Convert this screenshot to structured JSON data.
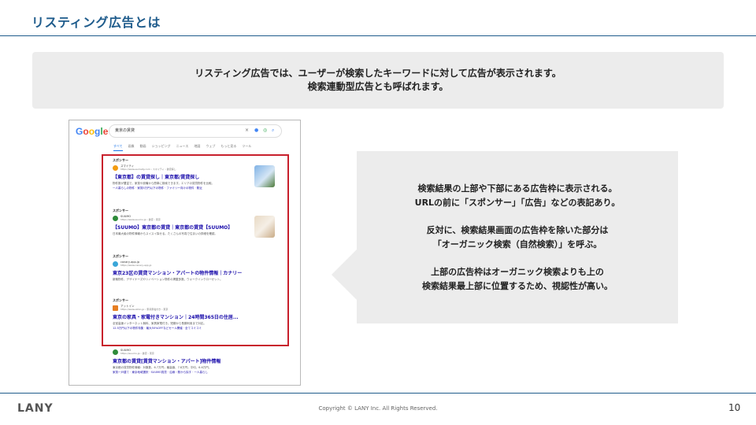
{
  "slide": {
    "title": "リスティング広告とは",
    "lead_line1": "リスティング広告では、ユーザーが検索したキーワードに対して広告が表示されます。",
    "lead_line2": "検索連動型広告とも呼ばれます。"
  },
  "serp": {
    "logo": [
      "G",
      "o",
      "o",
      "g",
      "l",
      "e"
    ],
    "query": "東京の賃貸",
    "search_icons": [
      "clear-icon",
      "mic-icon",
      "lens-icon",
      "search-icon"
    ],
    "tabs": [
      "すべて",
      "画像",
      "動画",
      "ショッピング",
      "ニュース",
      "地図",
      "ウェブ",
      "もっと見る",
      "ツール"
    ],
    "ads": [
      {
        "sponsored": "スポンサー",
        "site_name": "スマイティ",
        "site_url": "https://www.sumaity.com › スマイティ › 賃貸探し",
        "title": "【東京都】の賃貸探し｜東京都/賃貸探し",
        "desc": "物件数が豊富で、家賃や設備から簡単に検索できます。エリアの賃貸物件を比較。",
        "link": "一人暮らしの物件 · 家賃5万円以下の物件 · ファミリー向けの物件 · 駅近"
      },
      {
        "sponsored": "スポンサー",
        "site_name": "SUUMO",
        "site_url": "https://www.suumo.jp › 賃貸 › 東京",
        "title": "【SUUMO】東京都の賃貸｜東京都の賃貸【SUUMO】",
        "desc": "日本最大級の物件情報からスイスイ探せる。たくさんの写真で住まいの詳細を確認。",
        "link": ""
      },
      {
        "sponsored": "スポンサー",
        "site_name": "canary-app.jp",
        "site_url": "https://www.canary-app.jp",
        "title": "東京23区の賃貸マンション・アパートの物件情報｜カナリー",
        "desc": "新築物件、デザイナーズやリノベーション物件の掲載多数。ウォークインクローゼット。",
        "link": ""
      },
      {
        "sponsored": "スポンサー",
        "site_name": "アットイン",
        "site_url": "https://www.atinn.jp › 家具家電付き › 東京",
        "title": "東京の家具・家電付きマンション｜24時間365日の住居...",
        "desc": "全室高速インターネット無料、家具家電付き。短期から長期利用まで対応。",
        "link": "12.5万円以下の物件特集 · 最大50%OFFなどセール開催 · 全てコミコミ"
      }
    ],
    "organic": {
      "site_name": "SUUMO",
      "site_url": "https://suumo.jp › 賃貸 › 東京",
      "title": "東京都の賃貸[賃貸マンション・アパート]物件情報",
      "desc": "東京都の賃貸物件情報：対象数、6.7万円；最高値、7.8万円；平均、6.6万円。",
      "link": "家賃一戸建て · 東京地域選択 · SUUMO賃貸 · 沿線・駅から探す · 一人暮らし"
    }
  },
  "explanation": {
    "p1_line1": "検索結果の上部や下部にある広告枠に表示される。",
    "p1_line2": "URLの前に「スポンサー」「広告」などの表記あり。",
    "p2_line1": "反対に、検索結果画面の広告枠を除いた部分は",
    "p2_line2": "「オーガニック検索（自然検索）」を呼ぶ。",
    "p3_line1": "上部の広告枠はオーガニック検索よりも上の",
    "p3_line2": "検索結果最上部に位置するため、視認性が高い。"
  },
  "footer": {
    "logo": "LANY",
    "copyright": "Copyright © LANY Inc. All Rights Reserved.",
    "page_number": "10"
  },
  "colors": {
    "title_blue": "#1f5c8c",
    "ad_frame_red": "#c8202c",
    "link_blue": "#1a0dab",
    "box_grey": "#ececec"
  }
}
